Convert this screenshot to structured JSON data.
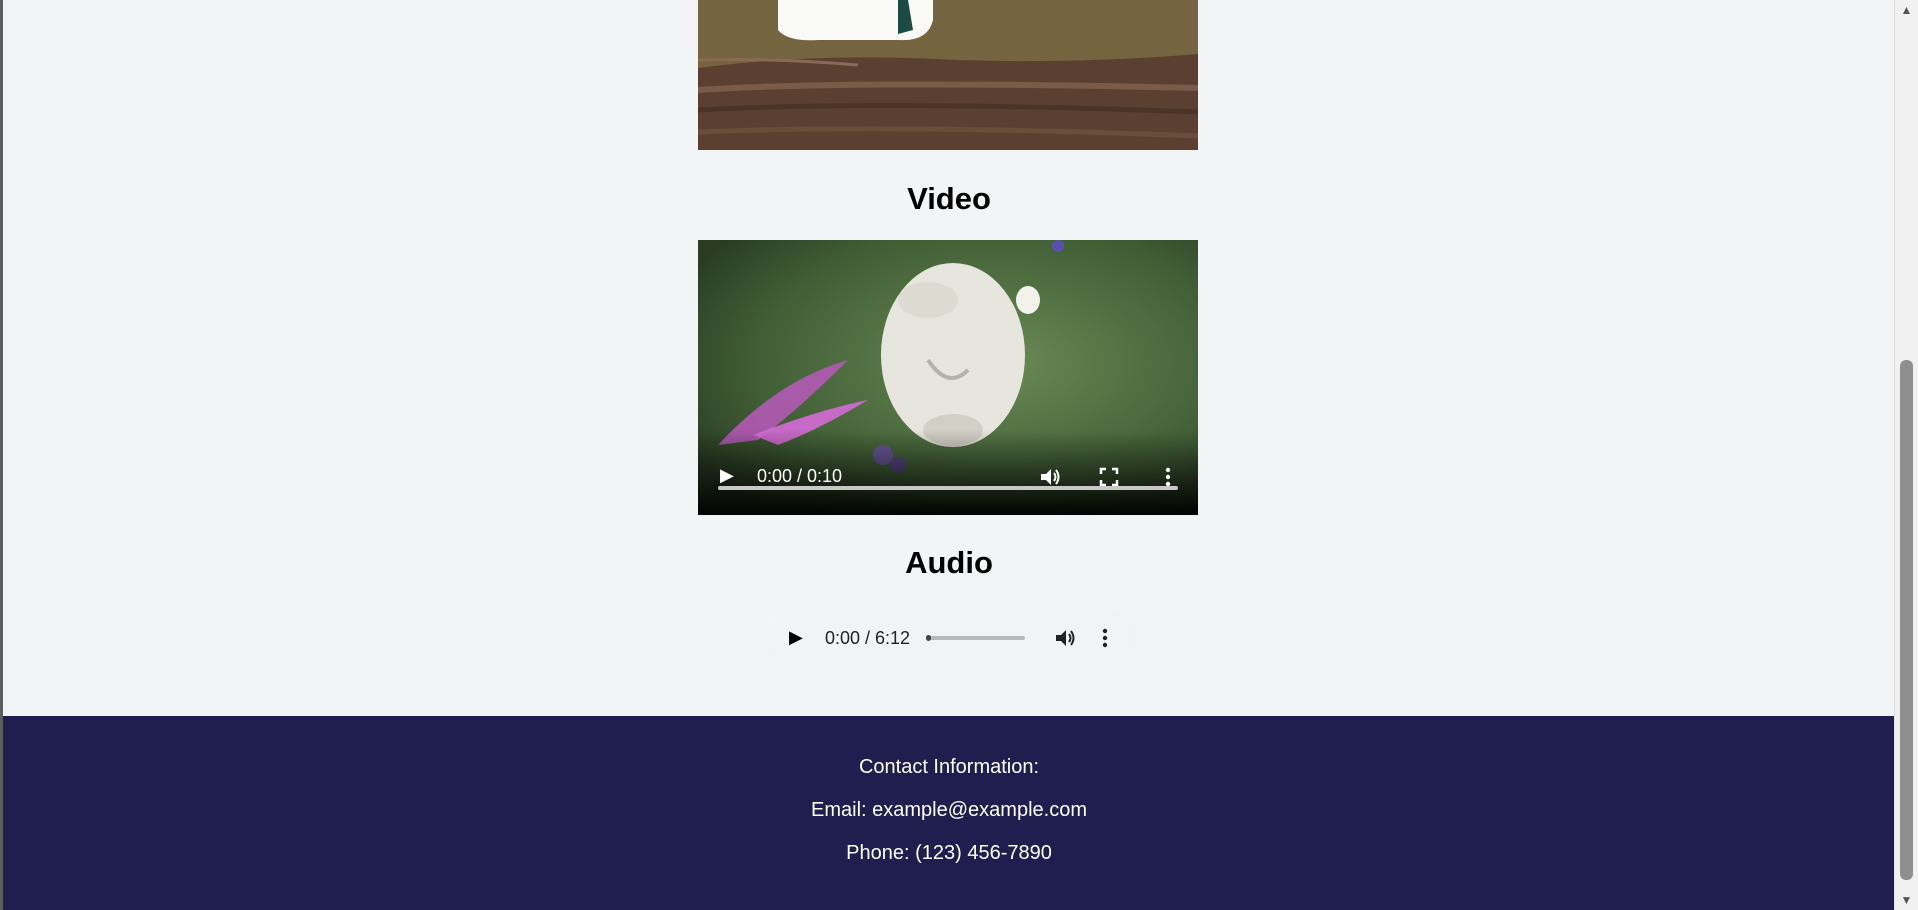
{
  "sections": {
    "video_heading": "Video",
    "audio_heading": "Audio"
  },
  "video": {
    "time": "0:00 / 0:10",
    "progress": 0,
    "icons": [
      "play-icon",
      "volume-icon",
      "fullscreen-icon",
      "more-options-icon"
    ]
  },
  "audio": {
    "time": "0:00 / 6:12",
    "progress": 0.02,
    "icons": [
      "play-icon",
      "volume-icon",
      "more-options-icon"
    ]
  },
  "footer": {
    "contact_label": "Contact Information:",
    "email": "Email: example@example.com",
    "phone": "Phone: (123) 456-7890"
  },
  "colors": {
    "page_bg": "#f3f4f5",
    "footer_bg": "#201d4f",
    "footer_text": "#ffffff"
  }
}
